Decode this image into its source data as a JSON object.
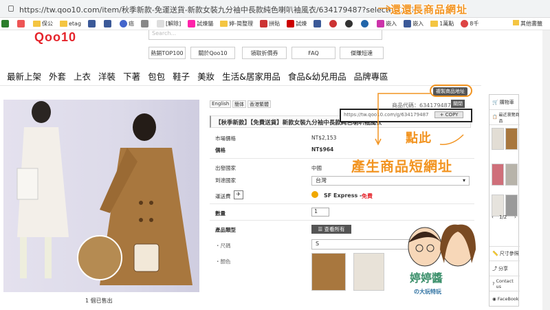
{
  "browser": {
    "url": "https://tw.qoo10.com/item/秋季新款-免運送貨-新款女裝九分袖中長款純色喇叭袖風衣/634179487?selectedOptions="
  },
  "bookmarks": [
    "",
    "",
    "保公",
    "",
    "etag",
    "",
    "",
    "",
    "癌",
    "",
    "[解除]",
    "",
    "試煉貓",
    "",
    "婷-简整理",
    "",
    "拼貼",
    "",
    "試煉",
    "",
    "",
    "",
    "",
    "",
    "嵌入",
    "",
    "嵌入",
    "",
    "1萬點",
    "8千",
    "",
    "",
    "其他書籤"
  ],
  "header": {
    "logo": "Qoo10",
    "search_placeholder": "Search...",
    "top_buttons": [
      "熱銷TOP100",
      "關於Qoo10",
      "領取折價券",
      "FAQ",
      "傑賺短達"
    ]
  },
  "nav": [
    "最新上架",
    "外套",
    "上衣",
    "洋裝",
    "下著",
    "包包",
    "鞋子",
    "美妝",
    "生活&居家用品",
    "食品&幼兒用品",
    "品牌專區"
  ],
  "product": {
    "languages": [
      "English",
      "簡体",
      "香港繁體"
    ],
    "code_label": "商品代碼：634179487",
    "title": "【秋季新款】【免費送貨】新款女裝九分袖中長款純色喇叭袖風衣",
    "market_price_label": "市場價格",
    "market_price": "NT$2,153",
    "price_label": "價格",
    "price": "NT$964",
    "origin_label": "出發國家",
    "origin": "中國",
    "dest_label": "到達國家",
    "dest": "台灣",
    "ship_label": "運送費",
    "ship_company": "SF Express -",
    "ship_free": "免費",
    "qty_label": "數量",
    "qty": "1",
    "type_label": "產品類型",
    "type_btn": "查看所有",
    "size_label": "・尺碼",
    "size": "S",
    "color_label": "・顏色",
    "sold": "1 個已售出"
  },
  "copy": {
    "button": "複製商品地址",
    "close": "關閉",
    "short_url": "https://tw.qoo10.com/g/634179487",
    "copy_btn": "+ COPY"
  },
  "sidebar": {
    "cart": "購物車",
    "recent": "最近瀏覽商品",
    "page": "1/2",
    "size_ref": "尺寸參照",
    "share": "分享",
    "contact": "Contact us",
    "facebook": "FaceBook"
  },
  "annotations": {
    "long_url": "還還長商品網址",
    "click": "點此",
    "short_url": "產生商品短網址",
    "watermark": "婷婷醬",
    "watermark_sub": "の大玩特玩"
  },
  "colors": {
    "accent": "#f29421",
    "brand": "#e5242b"
  }
}
